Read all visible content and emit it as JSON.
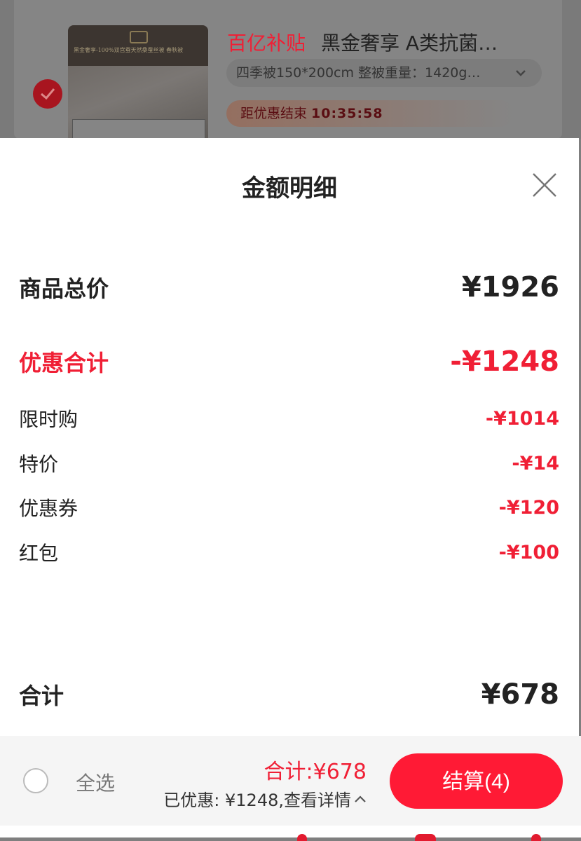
{
  "background": {
    "product_title_prefix": "百亿补贴",
    "product_title": "黑金奢享 A类抗菌…",
    "product_image_tag": "黑金奢享-100%双宫蚕天然桑蚕丝被 春秋被",
    "spec": "四季被150*200cm 整被重量：1420g…",
    "timer_label": "距优惠结束",
    "timer_value": "10:35:58"
  },
  "sheet": {
    "title": "金额明细",
    "product_total_label": "商品总价",
    "product_total_value": "¥1926",
    "discount_total_label": "优惠合计",
    "discount_total_value": "-¥1248",
    "discounts": [
      {
        "label": "限时购",
        "value": "-¥1014"
      },
      {
        "label": "特价",
        "value": "-¥14"
      },
      {
        "label": "优惠券",
        "value": "-¥120"
      },
      {
        "label": "红包",
        "value": "-¥100"
      }
    ],
    "grand_total_label": "合计",
    "grand_total_value": "¥678"
  },
  "bottom_bar": {
    "select_all_label": "全选",
    "total_text": "合计:¥678",
    "saved_text": "已优惠: ¥1248,查看详情",
    "checkout_label": "结算(4)"
  },
  "colors": {
    "accent": "#f01f35",
    "checkout_button": "#ff1a35"
  }
}
